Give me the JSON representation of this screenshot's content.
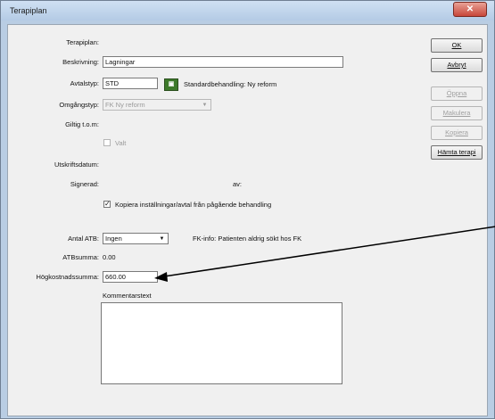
{
  "window": {
    "title": "Terapiplan",
    "close_symbol": "✕"
  },
  "form": {
    "terapiplan_label": "Terapiplan:",
    "beskrivning_label": "Beskrivning:",
    "beskrivning_value": "Lagningar",
    "avtalstyp_label": "Avtalstyp:",
    "avtalstyp_value": "STD",
    "avtalstyp_desc": "Standardbehandling: Ny reform",
    "omgangstyp_label": "Omgångstyp:",
    "omgangstyp_value": "FK Ny reform",
    "giltig_label": "Giltig t.o.m:",
    "valt_label": "Valt",
    "utskriftsdatum_label": "Utskriftsdatum:",
    "signerad_label": "Signerad:",
    "av_label": "av:",
    "kopiera_label": "Kopiera inställningar/avtal från pågående behandling",
    "antal_atb_label": "Antal ATB:",
    "antal_atb_value": "Ingen",
    "fk_info": "FK-info: Patienten aldrig sökt hos FK",
    "atbsumma_label": "ATBsumma:",
    "atbsumma_value": "0.00",
    "hogkostnad_label": "Högkostnadssumma:",
    "hogkostnad_value": "660.00",
    "kommentar_label": "Kommentarstext"
  },
  "buttons": {
    "ok": "OK",
    "avbryt": "Avbryt",
    "oppna": "Öppna",
    "makulera": "Makulera",
    "kopiera": "Kopiera",
    "hamta_terapi": "Hämta terapi"
  },
  "icons": {
    "lookup": "lookup-icon",
    "combo_arrow": "▼"
  }
}
